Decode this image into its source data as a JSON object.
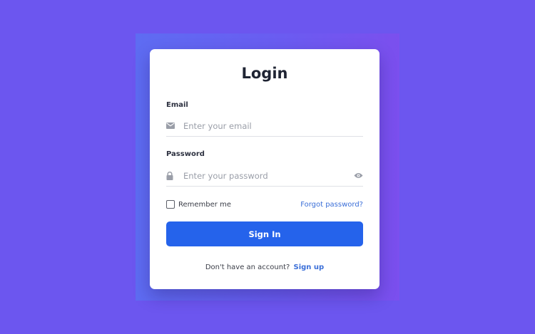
{
  "login": {
    "title": "Login",
    "email": {
      "label": "Email",
      "placeholder": "Enter your email",
      "value": ""
    },
    "password": {
      "label": "Password",
      "placeholder": "Enter your password",
      "value": ""
    },
    "remember_label": "Remember me",
    "remember_checked": false,
    "forgot_label": "Forgot password?",
    "submit_label": "Sign In",
    "footer_text": "Don't have an account?",
    "signup_label": "Sign up"
  },
  "icons": {
    "email": "envelope-icon",
    "password": "lock-icon",
    "toggle": "eye-icon"
  },
  "colors": {
    "background": "#6c56ef",
    "primary": "#2563eb",
    "link": "#3b6fd8",
    "title": "#1f2433"
  }
}
